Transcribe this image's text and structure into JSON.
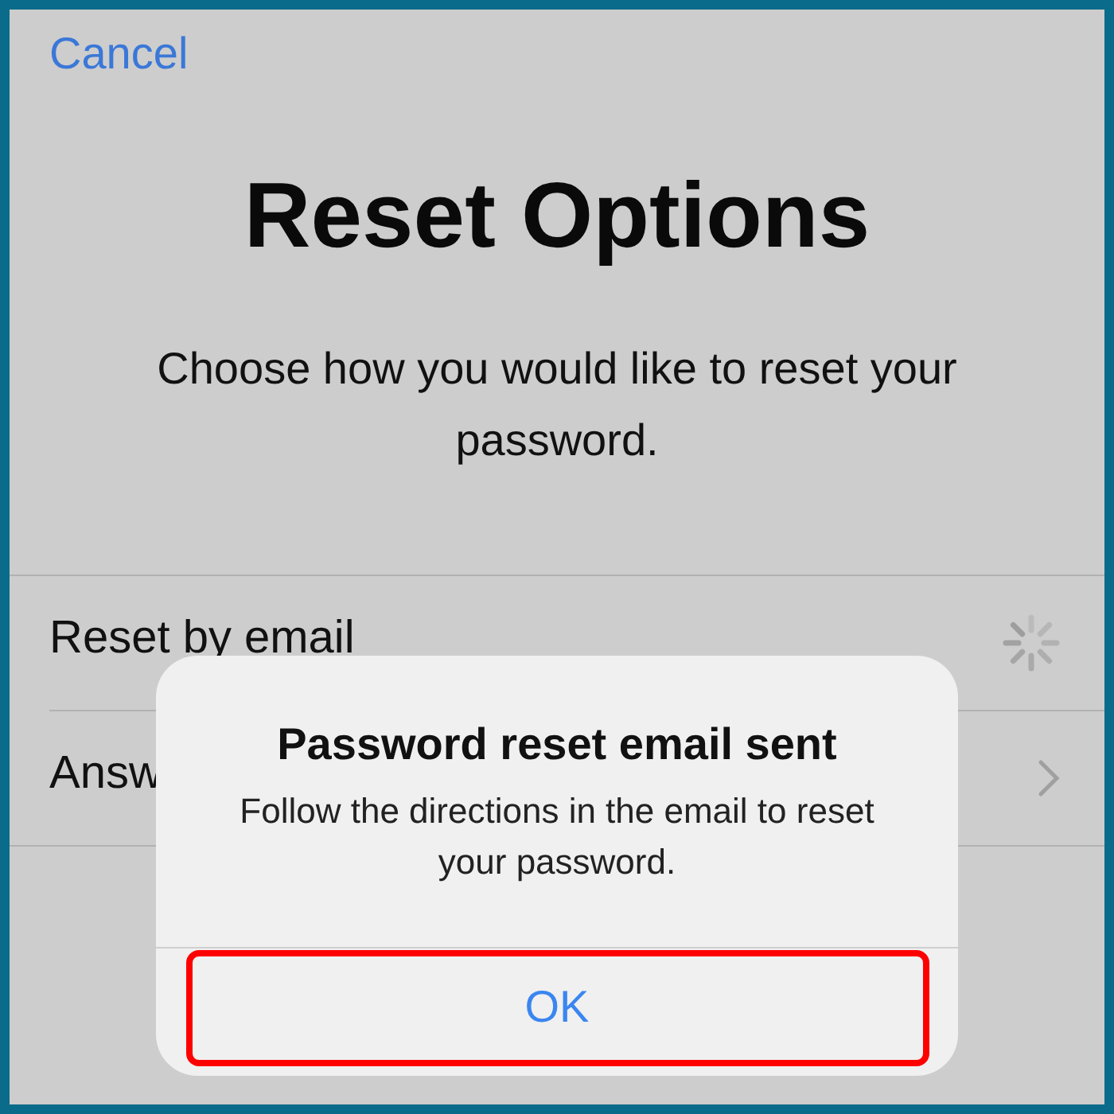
{
  "nav": {
    "cancel": "Cancel"
  },
  "title": "Reset Options",
  "subtitle": "Choose how you would like to reset your password.",
  "options": [
    {
      "label": "Reset by email",
      "kind": "spinner"
    },
    {
      "label": "Answ",
      "kind": "chevron"
    }
  ],
  "alert": {
    "title": "Password reset email sent",
    "message": "Follow the directions in the email to reset your password.",
    "buttons": [
      {
        "label": "OK",
        "highlighted": true
      }
    ]
  }
}
